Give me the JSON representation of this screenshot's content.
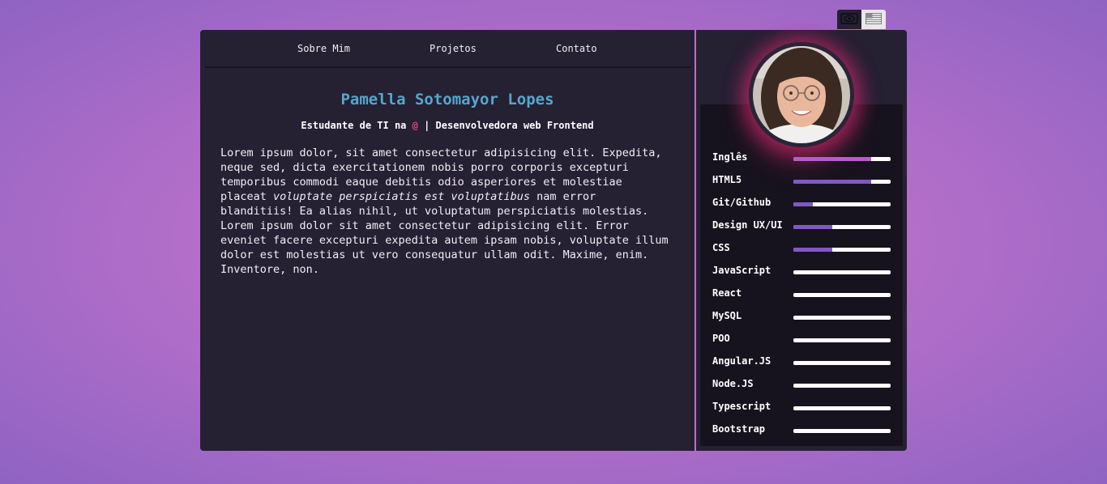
{
  "nav": {
    "items": [
      "Sobre Mim",
      "Projetos",
      "Contato"
    ]
  },
  "header": {
    "name": "Pamella Sotomayor Lopes",
    "subtitle_before": "Estudante de TI na ",
    "subtitle_at": "@",
    "subtitle_after": " | Desenvolvedora web Frontend"
  },
  "bio": {
    "p1_before": "Lorem ipsum dolor, sit amet consectetur adipisicing elit. Expedita, neque sed, dicta exercitationem nobis porro corporis excepturi temporibus commodi eaque debitis odio asperiores et molestiae placeat ",
    "p1_italic": "voluptate perspiciatis est voluptatibus",
    "p1_after": " nam error blanditiis! Ea alias nihil, ut voluptatum perspiciatis molestias.",
    "p2": "Lorem ipsum dolor sit amet consectetur adipisicing elit. Error eveniet facere excepturi expedita autem ipsam nobis, voluptate illum dolor est molestias ut vero consequatur ullam odit. Maxime, enim. Inventore, non."
  },
  "toggles": {
    "theme_icon": "eye-icon",
    "language_icon": "us-flag-icon"
  },
  "colors": {
    "accent": "#c06fca",
    "title": "#53a8cf",
    "at": "#e0457d",
    "panel": "#262033",
    "skill_fill_pink": "#b65dc5",
    "skill_fill_purple": "#8158c4"
  },
  "skills": [
    {
      "name": "Inglês",
      "level": 0.8,
      "color": "#b65dc5"
    },
    {
      "name": "HTML5",
      "level": 0.8,
      "color": "#8158c4"
    },
    {
      "name": "Git/Github",
      "level": 0.2,
      "color": "#8158c4"
    },
    {
      "name": "Design UX/UI",
      "level": 0.4,
      "color": "#8158c4"
    },
    {
      "name": "CSS",
      "level": 0.4,
      "color": "#8158c4"
    },
    {
      "name": "JavaScript",
      "level": 0,
      "color": "#8158c4"
    },
    {
      "name": "React",
      "level": 0,
      "color": "#8158c4"
    },
    {
      "name": "MySQL",
      "level": 0,
      "color": "#8158c4"
    },
    {
      "name": "POO",
      "level": 0,
      "color": "#8158c4"
    },
    {
      "name": "Angular.JS",
      "level": 0,
      "color": "#8158c4"
    },
    {
      "name": "Node.JS",
      "level": 0,
      "color": "#8158c4"
    },
    {
      "name": "Typescript",
      "level": 0,
      "color": "#8158c4"
    },
    {
      "name": "Bootstrap",
      "level": 0,
      "color": "#8158c4"
    }
  ]
}
